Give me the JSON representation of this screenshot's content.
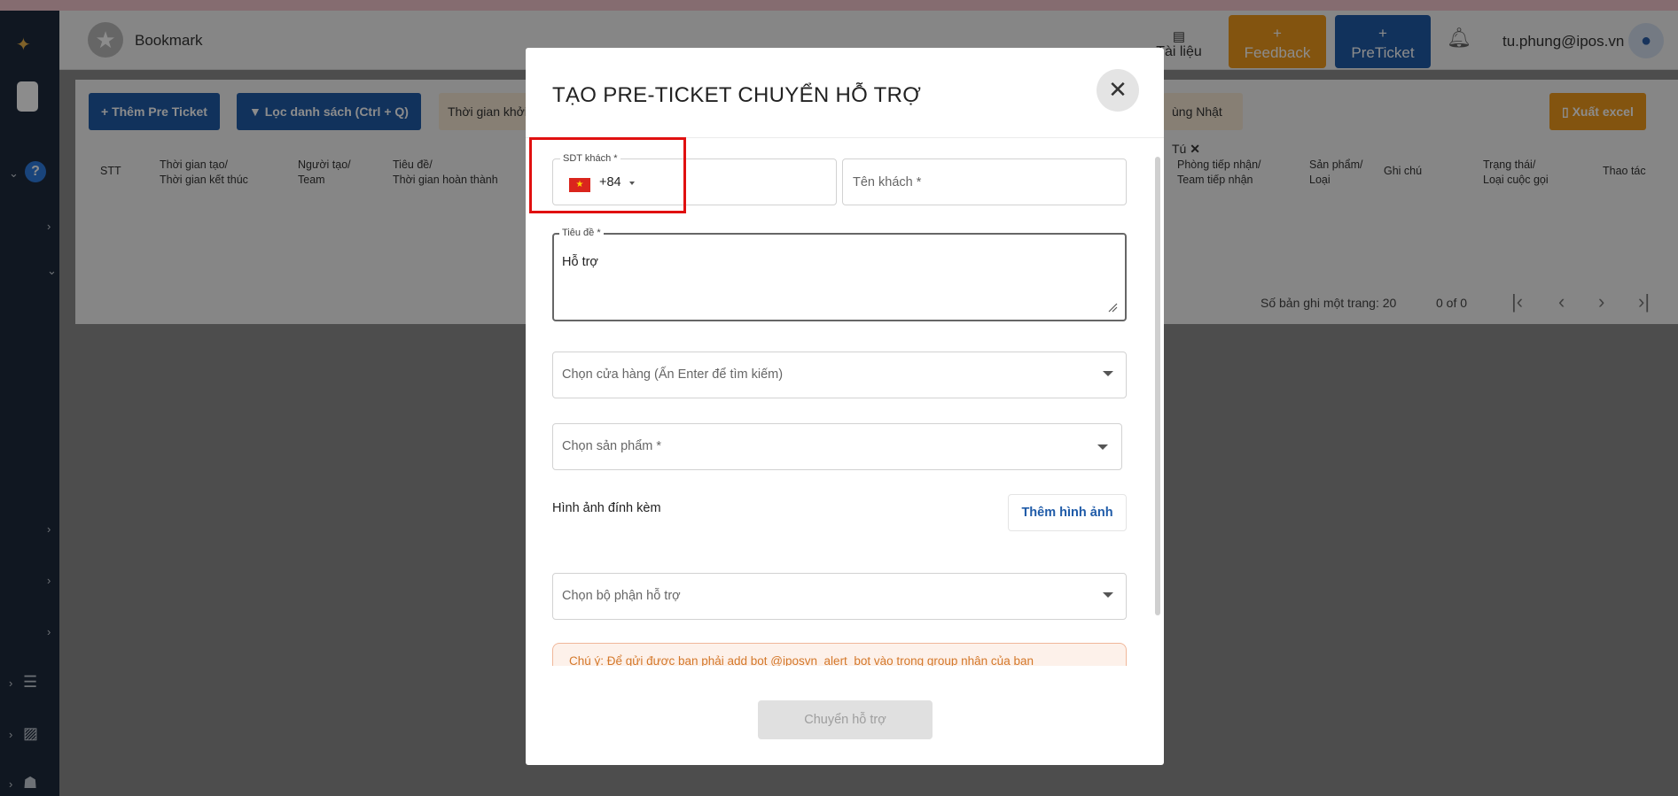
{
  "header": {
    "title": "Bookmark",
    "doc_label": "Tài liệu",
    "feedback_label": "+\nFeedback",
    "feedback_plus": "+",
    "feedback_text": "Feedback",
    "preticket_plus": "+",
    "preticket_text": "PreTicket",
    "user_email": "tu.phung@ipos.vn"
  },
  "toolbar": {
    "add_preticket": "+ Thêm Pre Ticket",
    "filter_list": "Lọc danh sách (Ctrl + Q)",
    "time_filter": "Thời gian khởi",
    "user_filter": "ùng Nhật Tú",
    "export_excel": "Xuất excel"
  },
  "table": {
    "columns": [
      [
        "STT",
        ""
      ],
      [
        "Thời gian tạo/",
        "Thời gian kết thúc"
      ],
      [
        "Người tạo/",
        "Team"
      ],
      [
        "Tiêu đề/",
        "Thời gian hoàn thành"
      ],
      [
        "Phòng tiếp nhận/",
        "Team tiếp nhận"
      ],
      [
        "Sản phẩm/",
        "Loại"
      ],
      [
        "Ghi chú",
        ""
      ],
      [
        "Trạng thái/",
        "Loại cuộc gọi"
      ],
      [
        "Thao tác",
        ""
      ]
    ],
    "rows_per_page_label": "Số bản ghi một trang:",
    "rows_per_page_value": "20",
    "range_label": "0 of 0"
  },
  "modal": {
    "title": "TẠO PRE-TICKET CHUYỂN HỖ TRỢ",
    "phone": {
      "label": "SDT khách *",
      "dial_code": "+84",
      "country": "VN"
    },
    "customer_name": {
      "placeholder": "Tên khách *"
    },
    "subject": {
      "label": "Tiêu đề *",
      "value": "Hỗ trợ"
    },
    "store_select": {
      "placeholder": "Chọn cửa hàng (Ấn Enter để tìm kiếm)"
    },
    "product_select": {
      "placeholder": "Chọn sản phẩm *"
    },
    "attachments_label": "Hình ảnh đính kèm",
    "add_image_button": "Thêm hình ảnh",
    "department_select": {
      "placeholder": "Chọn bộ phận hỗ trợ"
    },
    "note": "Chú ý: Để gửi được bạn phải add bot @iposvn_alert_bot vào trong group nhận của bạn",
    "submit_button": "Chuyển hỗ trợ"
  },
  "colors": {
    "primary": "#1f5ba8",
    "feedback": "#ef9a1d",
    "sidebar": "#1e2a3c",
    "highlight_box": "#e01010"
  }
}
